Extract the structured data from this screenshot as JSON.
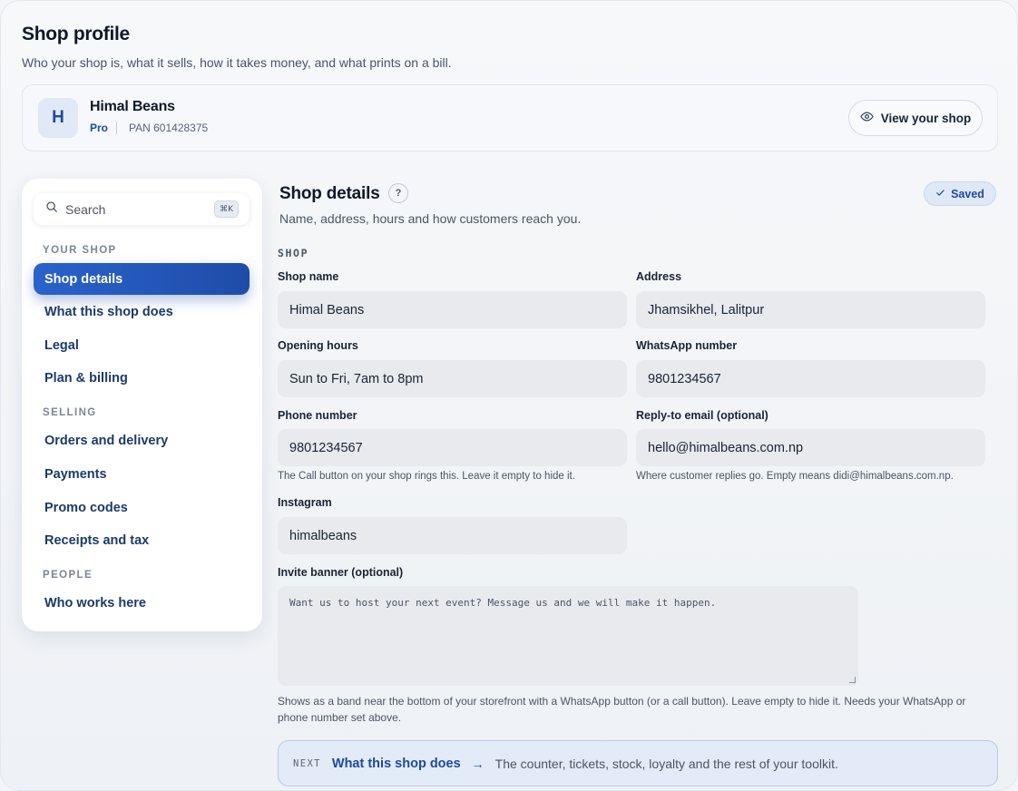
{
  "header": {
    "title": "Shop profile",
    "subtitle": "Who your shop is, what it sells, how it takes money, and what prints on a bill."
  },
  "shop": {
    "initial": "H",
    "name": "Himal Beans",
    "plan": "Pro",
    "pan": "PAN 601428375",
    "view_button": "View your shop"
  },
  "sidebar": {
    "search_placeholder": "Search",
    "shortcut": "⌘K",
    "sections": [
      {
        "label": "YOUR SHOP",
        "items": [
          "Shop details",
          "What this shop does",
          "Legal",
          "Plan & billing"
        ]
      },
      {
        "label": "SELLING",
        "items": [
          "Orders and delivery",
          "Payments",
          "Promo codes",
          "Receipts and tax"
        ]
      },
      {
        "label": "PEOPLE",
        "items": [
          "Who works here"
        ]
      }
    ],
    "active_item": "Shop details"
  },
  "main": {
    "title": "Shop details",
    "help": "?",
    "subtitle": "Name, address, hours and how customers reach you.",
    "status": "Saved",
    "group_label": "SHOP",
    "fields": {
      "shop_name": {
        "label": "Shop name",
        "value": "Himal Beans"
      },
      "address": {
        "label": "Address",
        "value": "Jhamsikhel, Lalitpur"
      },
      "opening_hours": {
        "label": "Opening hours",
        "value": "Sun to Fri, 7am to 8pm"
      },
      "whatsapp": {
        "label": "WhatsApp number",
        "value": "9801234567"
      },
      "phone": {
        "label": "Phone number",
        "value": "9801234567",
        "hint": "The Call button on your shop rings this. Leave it empty to hide it."
      },
      "reply_email": {
        "label": "Reply-to email (optional)",
        "value": "hello@himalbeans.com.np",
        "hint": "Where customer replies go. Empty means didi@himalbeans.com.np."
      },
      "instagram": {
        "label": "Instagram",
        "value": "himalbeans"
      },
      "invite_banner": {
        "label": "Invite banner (optional)",
        "placeholder": "Want us to host your next event? Message us and we will make it happen.",
        "hint": "Shows as a band near the bottom of your storefront with a WhatsApp button (or a call button). Leave empty to hide it. Needs your WhatsApp or phone number set above."
      }
    },
    "next": {
      "tag": "NEXT",
      "link": "What this shop does",
      "arrow": "→",
      "description": "The counter, tickets, stock, loyalty and the rest of your toolkit."
    }
  }
}
